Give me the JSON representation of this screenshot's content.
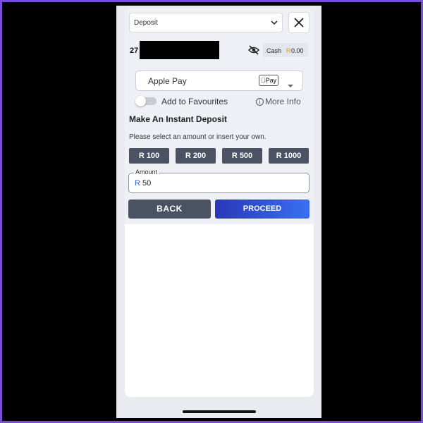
{
  "header": {
    "dropdown_label": "Deposit",
    "dropdown_icon": "chevron-down-icon",
    "close_icon": "close-icon"
  },
  "account": {
    "number_visible": "27",
    "cash_label": "Cash",
    "currency": "R",
    "balance": "0.00",
    "visibility_icon": "eye-off-icon"
  },
  "payment_method": {
    "name": "Apple Pay",
    "badge": "Pay",
    "caret_icon": "caret-down-icon"
  },
  "favourites": {
    "label": "Add to Favourites",
    "toggle_on": false,
    "more_info": "More Info"
  },
  "deposit": {
    "heading": "Make An Instant Deposit",
    "instruction": "Please select an amount or insert your own.",
    "quick_amounts": [
      "R 100",
      "R 200",
      "R 500",
      "R 1000"
    ],
    "amount_label": "Amount",
    "amount_currency": "R",
    "amount_value": "50"
  },
  "actions": {
    "back": "BACK",
    "proceed": "PROCEED"
  },
  "colors": {
    "frame": "#7a4fd8",
    "button_dark": "#4a5263",
    "proceed_start": "#2938b8",
    "proceed_end": "#3a6ff2",
    "cash_currency": "#e2a400"
  }
}
